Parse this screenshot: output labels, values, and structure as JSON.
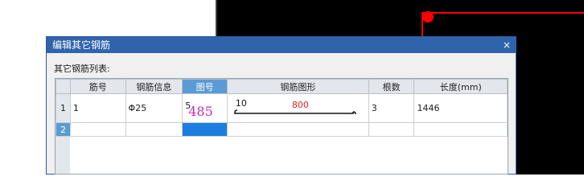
{
  "dialog": {
    "title": "编辑其它钢筋",
    "close_glyph": "×",
    "section_label": "其它钢筋列表:"
  },
  "table": {
    "columns": [
      "",
      "筋号",
      "钢筋信息",
      "图号",
      "钢筋图形",
      "根数",
      "长度(mm)"
    ],
    "rows": [
      {
        "row_number": "1",
        "bar_number": "1",
        "bar_info": "Φ25",
        "figure_no_small": "5",
        "figure_no_large": "485",
        "shape_left_value": "10",
        "shape_mid_value": "800",
        "count": "3",
        "length": "1446"
      },
      {
        "row_number": "2",
        "bar_number": "",
        "bar_info": "",
        "figure_no_small": "",
        "figure_no_large": "",
        "shape_left_value": "",
        "shape_mid_value": "",
        "count": "",
        "length": ""
      }
    ]
  },
  "colors": {
    "titlebar": "#2f64ad",
    "header_active": "#5b9bd5",
    "selected_cell": "#1a7fe0",
    "shape_value": "#e02020",
    "figure_no": "#c02bc0",
    "cad_background": "#000000",
    "cad_red": "#ff0000"
  }
}
